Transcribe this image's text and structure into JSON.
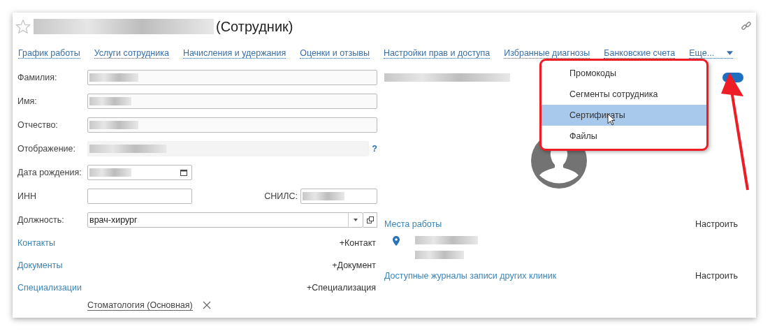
{
  "window": {
    "title": "(Сотрудник)"
  },
  "nav_links": [
    {
      "label": "График работы"
    },
    {
      "label": "Услуги сотрудника"
    },
    {
      "label": "Начисления и удержания"
    },
    {
      "label": "Оценки и отзывы"
    },
    {
      "label": "Настройки прав и доступа"
    },
    {
      "label": "Избранные диагнозы"
    },
    {
      "label": "Банковские счета"
    },
    {
      "label": "Еще..."
    }
  ],
  "more_menu": {
    "items": [
      {
        "label": "Промокоды",
        "selected": false
      },
      {
        "label": "Сегменты сотрудника",
        "selected": false
      },
      {
        "label": "Сертификаты",
        "selected": true
      },
      {
        "label": "Файлы",
        "selected": false
      }
    ]
  },
  "form": {
    "last_name": {
      "label": "Фамилия:"
    },
    "first_name": {
      "label": "Имя:"
    },
    "middle_name": {
      "label": "Отчество:"
    },
    "display": {
      "label": "Отображение:",
      "help": "?"
    },
    "birth_date": {
      "label": "Дата рождения:"
    },
    "inn": {
      "label": "ИНН"
    },
    "snils": {
      "label": "СНИЛС:"
    },
    "position": {
      "label": "Должность:",
      "value": "врач-хирург"
    }
  },
  "sections_left": [
    {
      "title": "Контакты",
      "action": "+Контакт"
    },
    {
      "title": "Документы",
      "action": "+Документ"
    },
    {
      "title": "Специализации",
      "action": "+Специализация"
    }
  ],
  "specializations": [
    {
      "label": "Стоматология (Основная)"
    }
  ],
  "toggle": {
    "on": true
  },
  "sections_right": [
    {
      "title": "Места работы",
      "action": "Настроить"
    },
    {
      "title": "Доступные журналы записи других клиник",
      "action": "Настроить"
    }
  ]
}
